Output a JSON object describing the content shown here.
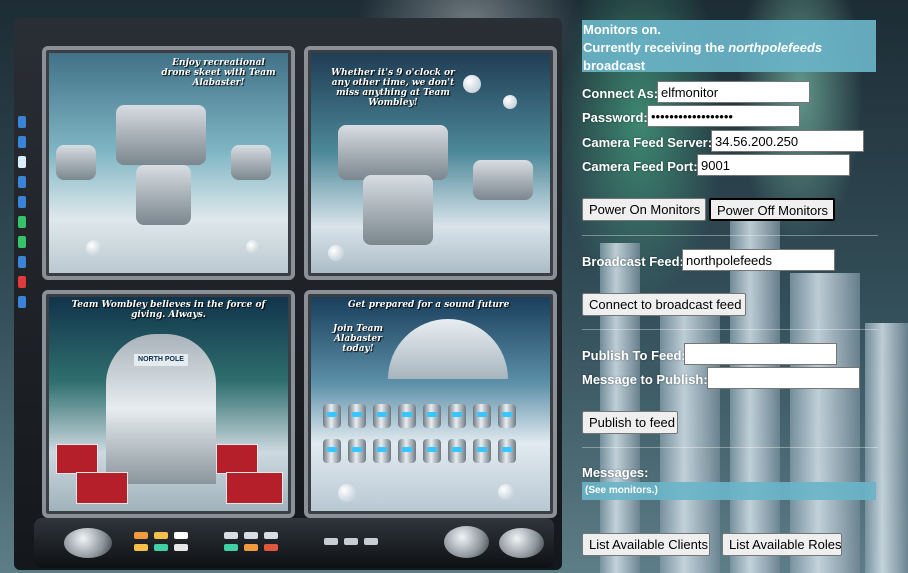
{
  "monitor_captions": {
    "screen1": "Enjoy recreational drone skeet with Team Alabaster!",
    "screen2": "Whether it's 9 o'clock or any other time, we don't miss anything at Team Wombley!",
    "screen3": "Team Wombley believes in the force of giving. Always.",
    "screen4_top": "Get prepared for a sound future",
    "screen4_mid": "Join Team Alabaster today!",
    "kiosk_sign": "NORTH POLE"
  },
  "status": {
    "line1": "Monitors on.",
    "line2_prefix": "Currently receiving the ",
    "feed_name": "northpolefeeds",
    "line3": "broadcast"
  },
  "connection": {
    "connect_as_label": "Connect As:",
    "connect_as_value": "elfmonitor",
    "password_label": "Password:",
    "password_value": "••••••••••••••••••",
    "server_label": "Camera Feed Server:",
    "server_value": "34.56.200.250",
    "port_label": "Camera Feed Port:",
    "port_value": "9001",
    "power_on_label": "Power On Monitors",
    "power_off_label": "Power Off Monitors"
  },
  "broadcast": {
    "feed_label": "Broadcast Feed:",
    "feed_value": "northpolefeeds",
    "connect_label": "Connect to broadcast feed"
  },
  "publish": {
    "feed_label": "Publish To Feed:",
    "feed_value": "",
    "message_label": "Message to Publish:",
    "message_value": "",
    "publish_label": "Publish to feed"
  },
  "messages": {
    "label": "Messages:",
    "content": "(See monitors.)"
  },
  "footer": {
    "clients_label": "List Available Clients",
    "roles_label": "List Available Roles"
  }
}
